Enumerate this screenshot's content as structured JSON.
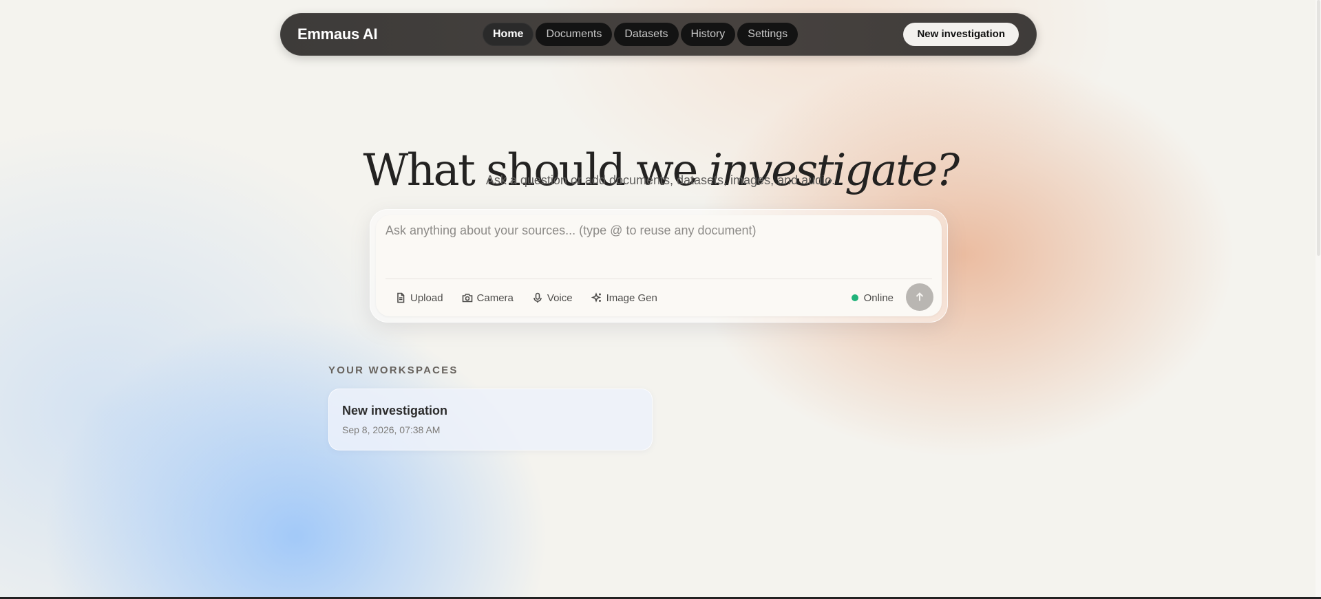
{
  "nav": {
    "brand": "Emmaus AI",
    "tabs": [
      {
        "label": "Home",
        "active": true
      },
      {
        "label": "Documents",
        "active": false
      },
      {
        "label": "Datasets",
        "active": false
      },
      {
        "label": "History",
        "active": false
      },
      {
        "label": "Settings",
        "active": false
      }
    ],
    "cta_label": "New investigation"
  },
  "hero": {
    "title_plain": "What should we ",
    "title_italic": "investigate?",
    "subtitle": "Ask a question or add documents, datasets, images, and audio."
  },
  "composer": {
    "placeholder": "Ask anything about your sources... (type @ to reuse any document)",
    "value": "",
    "tools": [
      {
        "label": "Upload",
        "icon": "file-icon"
      },
      {
        "label": "Camera",
        "icon": "camera-icon"
      },
      {
        "label": "Voice",
        "icon": "microphone-icon"
      },
      {
        "label": "Image Gen",
        "icon": "sparkles-icon"
      }
    ],
    "status_label": "Online",
    "status_color": "#21b37a",
    "send_icon": "arrow-up-icon"
  },
  "workspaces": {
    "heading": "YOUR WORKSPACES",
    "items": [
      {
        "title": "New investigation",
        "date": "Sep 8, 2026, 07:38 AM"
      }
    ]
  },
  "colors": {
    "nav_bg": "#3d3b39",
    "accent_online": "#21b37a",
    "send_button": "#b9b6b2"
  }
}
